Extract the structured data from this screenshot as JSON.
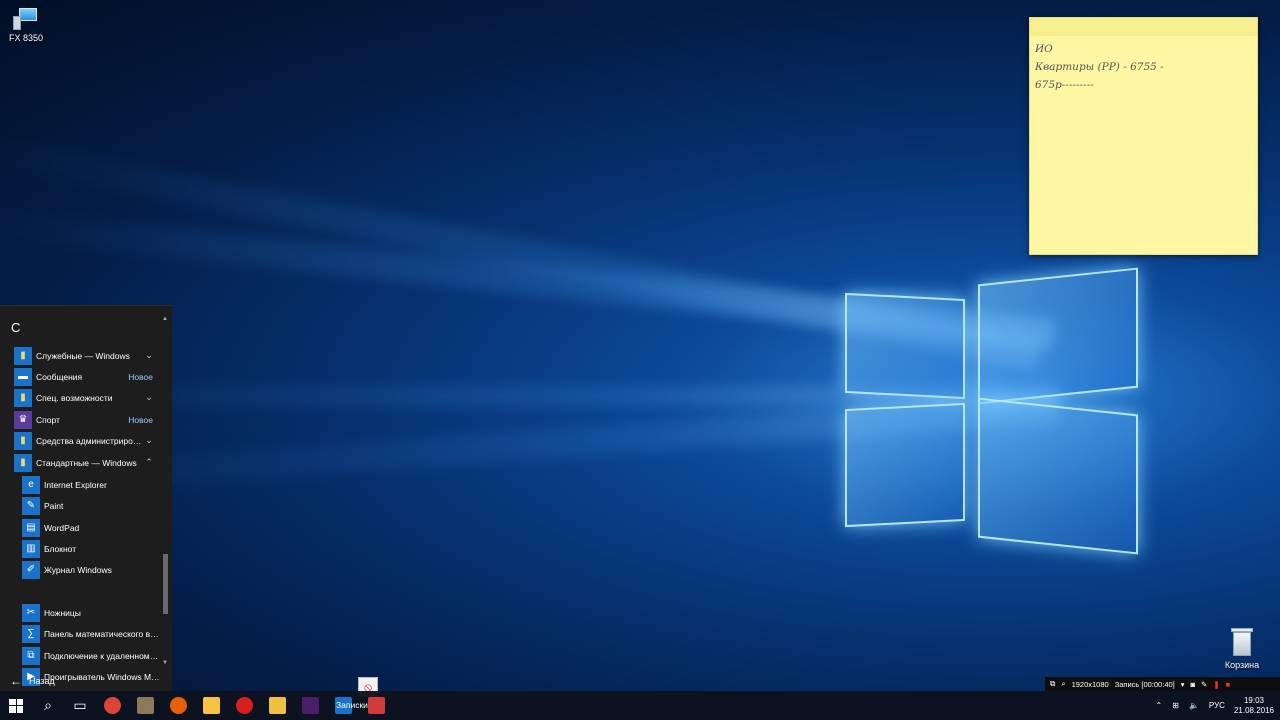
{
  "desktop": {
    "icons": [
      {
        "label": "FX 8350"
      },
      {
        "label": "Корзина"
      }
    ]
  },
  "sticky_note": {
    "text": "ИО\nКвартиры (РР) - 6755 -\n675р---------"
  },
  "start_menu": {
    "section_letter": "С",
    "items": [
      {
        "label": "Служебные — Windows",
        "badge": "",
        "chevron": "⌄",
        "tile_color": "#1a73c8",
        "icon": "folder-icon"
      },
      {
        "label": "Сообщения",
        "badge": "Новое",
        "chevron": "",
        "tile_color": "#1a73c8",
        "icon": "message-icon"
      },
      {
        "label": "Спец. возможности",
        "badge": "",
        "chevron": "⌄",
        "tile_color": "#1a73c8",
        "icon": "folder-icon"
      },
      {
        "label": "Спорт",
        "badge": "Новое",
        "chevron": "",
        "tile_color": "#5a3a9a",
        "icon": "trophy-icon"
      },
      {
        "label": "Средства администрирован...",
        "badge": "",
        "chevron": "⌄",
        "tile_color": "#1a73c8",
        "icon": "folder-icon"
      },
      {
        "label": "Стандартные — Windows",
        "badge": "",
        "chevron": "⌃",
        "tile_color": "#1a73c8",
        "icon": "folder-icon"
      }
    ],
    "sub_items": [
      {
        "label": "Internet Explorer",
        "tile_color": "#1a73c8",
        "icon": "internet-explorer-icon"
      },
      {
        "label": "Paint",
        "tile_color": "#1a73c8",
        "icon": "paint-icon"
      },
      {
        "label": "WordPad",
        "tile_color": "#1a73c8",
        "icon": "wordpad-icon"
      },
      {
        "label": "Блокнот",
        "tile_color": "#1a73c8",
        "icon": "notepad-icon"
      },
      {
        "label": "Журнал Windows",
        "tile_color": "#1a73c8",
        "icon": "journal-icon"
      },
      {
        "label": "Ножницы",
        "tile_color": "#1a73c8",
        "icon": "scissors-icon"
      },
      {
        "label": "Панель математического ввода",
        "tile_color": "#1a73c8",
        "icon": "math-input-icon"
      },
      {
        "label": "Подключение к удаленному р...",
        "tile_color": "#1a73c8",
        "icon": "remote-desktop-icon"
      },
      {
        "label": "Проигрыватель Windows Media",
        "tile_color": "#1a73c8",
        "icon": "media-player-icon"
      }
    ],
    "back_label": "Назад"
  },
  "taskbar": {
    "apps": [
      {
        "name": "chrome-icon",
        "color": "#db4437"
      },
      {
        "name": "gimp-icon",
        "color": "#8a7a5a"
      },
      {
        "name": "firefox-icon",
        "color": "#e66000"
      },
      {
        "name": "folder-sync-icon",
        "color": "#f5c242"
      },
      {
        "name": "record-icon",
        "color": "#d61f1f"
      },
      {
        "name": "file-explorer-icon",
        "color": "#f0c040"
      },
      {
        "name": "premiere-icon",
        "color": "#4a1f6a"
      },
      {
        "name": "outlook-icon",
        "color": "#1a73c8"
      },
      {
        "name": "sticky-notes-icon",
        "color": "#d03a3a"
      }
    ],
    "active_label": "Записки",
    "tray": {
      "language": "РУС",
      "time": "19:03",
      "date": "21.08.2016"
    }
  },
  "recorder": {
    "resolution": "1920x1080",
    "status": "Запись [00:00:40]"
  }
}
